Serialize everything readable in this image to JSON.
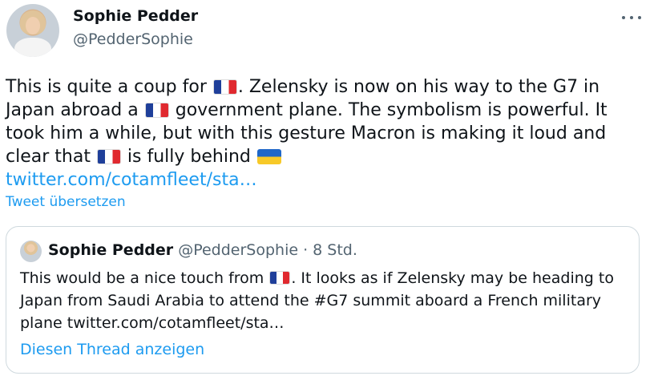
{
  "author": {
    "display_name": "Sophie Pedder",
    "handle": "@PedderSophie"
  },
  "tweet": {
    "text_1": "This is quite a coup for ",
    "text_2": ". Zelensky is now on his way to the G7 in Japan abroad a ",
    "text_3": " government plane. The symbolism is powerful. It took him a while, but with this gesture Macron is making it loud and clear that ",
    "text_4": " is fully behind ",
    "link": "twitter.com/cotamfleet/sta…",
    "translate_label": "Tweet übersetzen"
  },
  "quote": {
    "display_name": "Sophie Pedder",
    "meta": "@PedderSophie · 8 Std.",
    "text_1": "This would be a nice touch from ",
    "text_2": ". It looks as if Zelensky may be heading to Japan from Saudi Arabia to attend the #G7 summit aboard a French military plane twitter.com/cotamfleet/sta…",
    "thread_label": "Diesen Thread anzeigen"
  },
  "icons": {
    "more": "more-icon",
    "flag_france": "flag-france-icon",
    "flag_ukraine": "flag-ukraine-icon"
  },
  "colors": {
    "link": "#1d9bf0",
    "secondary_text": "#536471",
    "border": "#cfd9de"
  }
}
